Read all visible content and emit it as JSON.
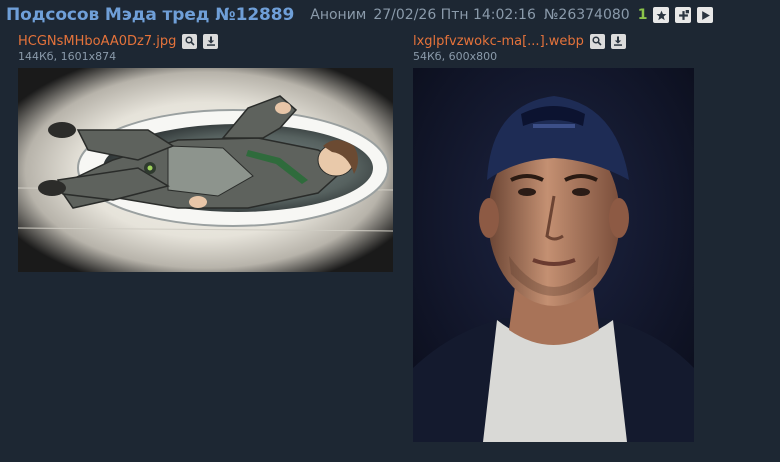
{
  "post": {
    "title": "Подсосов Мэда тред №12889",
    "author": "Аноним",
    "date": "27/02/26 Птн 14:02:16",
    "number": "№26374080",
    "reply_count": "1"
  },
  "icons": {
    "favorite": "star-icon",
    "hide": "plus-icon",
    "play": "play-icon",
    "search": "search-icon",
    "download": "download-icon"
  },
  "colors": {
    "background": "#1d2733",
    "title": "#6f9fd8",
    "filename": "#e5733b",
    "meta": "#8a9aaa",
    "reply_count": "#8bc34a"
  },
  "files": [
    {
      "name": "HCGNsMHboAA0Dz7.jpg",
      "size": "144Кб",
      "dimensions": "1601x874"
    },
    {
      "name": "lxglpfvzwokc-ma[...].webp",
      "size": "54Кб",
      "dimensions": "600x800"
    }
  ]
}
